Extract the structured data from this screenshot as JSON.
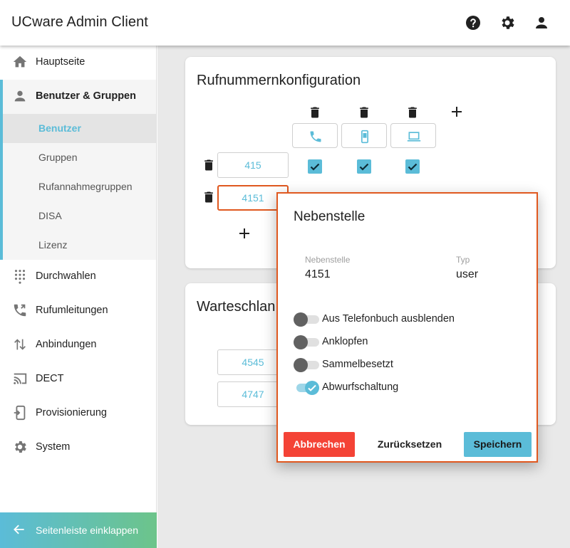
{
  "header": {
    "title": "UCware Admin Client",
    "icons": [
      "help-icon",
      "gear-icon",
      "account-icon"
    ]
  },
  "sidebar": {
    "items": [
      {
        "label": "Hauptseite",
        "icon": "home-icon"
      },
      {
        "label": "Benutzer & Gruppen",
        "icon": "user-icon"
      },
      {
        "label": "Durchwahlen",
        "icon": "dialpad-icon"
      },
      {
        "label": "Rufumleitungen",
        "icon": "phone-forward-icon"
      },
      {
        "label": "Anbindungen",
        "icon": "swap-vertical-icon"
      },
      {
        "label": "DECT",
        "icon": "cast-icon"
      },
      {
        "label": "Provisionierung",
        "icon": "provision-icon"
      },
      {
        "label": "System",
        "icon": "gear-icon"
      }
    ],
    "subitems": [
      {
        "label": "Benutzer",
        "active": true
      },
      {
        "label": "Gruppen",
        "active": false
      },
      {
        "label": "Rufannahmegruppen",
        "active": false
      },
      {
        "label": "DISA",
        "active": false
      },
      {
        "label": "Lizenz",
        "active": false
      }
    ],
    "collapse_label": "Seitenleiste einklappen"
  },
  "main": {
    "card1": {
      "title": "Rufnummernkonfiguration",
      "devices": [
        "phone-icon",
        "mobile-icon",
        "laptop-icon"
      ],
      "numbers": [
        "415",
        "4151"
      ]
    },
    "card2": {
      "title": "Warteschlan",
      "numbers": [
        "4545",
        "4747"
      ]
    }
  },
  "dialog": {
    "title": "Nebenstelle",
    "field1_label": "Nebenstelle",
    "field1_value": "4151",
    "field2_label": "Typ",
    "field2_value": "user",
    "toggles": [
      {
        "label": "Aus Telefonbuch ausblenden",
        "on": false
      },
      {
        "label": "Anklopfen",
        "on": false
      },
      {
        "label": "Sammelbesetzt",
        "on": false
      },
      {
        "label": "Abwurfschaltung",
        "on": true
      }
    ],
    "cancel_label": "Abbrechen",
    "reset_label": "Zurücksetzen",
    "save_label": "Speichern"
  },
  "colors": {
    "accent": "#5bbcd8",
    "danger": "#f44336",
    "highlight": "#e0581f"
  }
}
